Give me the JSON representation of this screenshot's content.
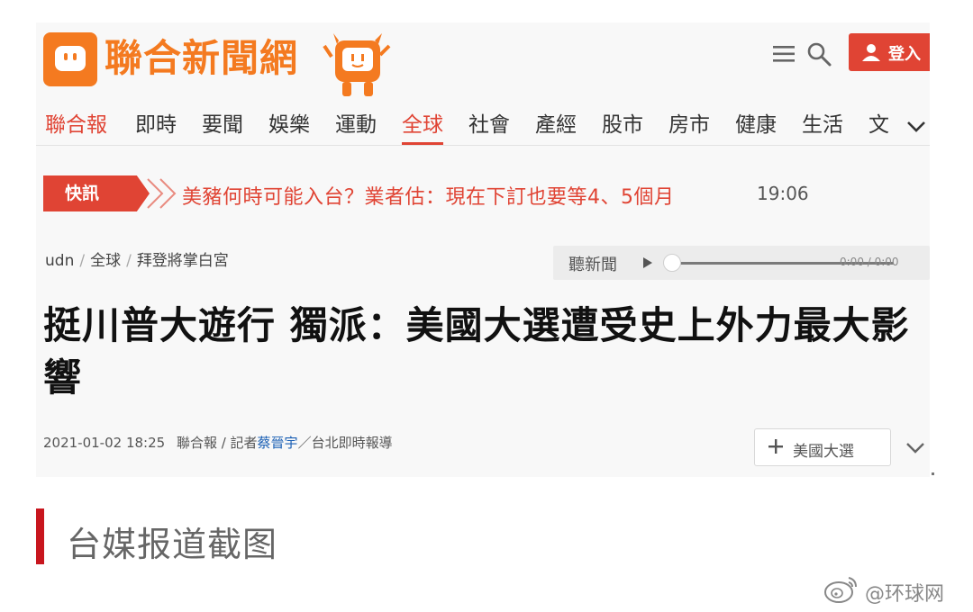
{
  "header": {
    "site_name": "聯合新聞網",
    "mascot_label": "udn",
    "login_label": "登入"
  },
  "nav": {
    "items": [
      "聯合報",
      "即時",
      "要聞",
      "娛樂",
      "運動",
      "全球",
      "社會",
      "產經",
      "股市",
      "房市",
      "健康",
      "生活",
      "文"
    ],
    "active": "全球"
  },
  "breaking": {
    "tag": "快訊",
    "headline": "美豬何時可能入台？業者估：現在下訂也要等4、5個月",
    "time": "19:06"
  },
  "breadcrumb": {
    "items": [
      "udn",
      "全球",
      "拜登將掌白宮"
    ]
  },
  "player": {
    "label": "聽新聞",
    "time": "0:00 / 0:00"
  },
  "article": {
    "title": "挺川普大遊行 獨派：美國大選遭受史上外力最大影響",
    "datetime": "2021-01-02 18:25",
    "source": "聯合報 / 記者",
    "reporter": "蔡晉宇",
    "bureau": "／台北即時報導",
    "tag_button": "美國大選"
  },
  "caption": {
    "text": "台媒报道截图"
  },
  "watermark": {
    "text": "@环球网"
  },
  "colors": {
    "brand_orange": "#f47a20",
    "accent_red": "#e04434",
    "caption_bar": "#c8161e"
  },
  "icons": [
    "menu-icon",
    "search-icon",
    "user-icon",
    "play-icon",
    "plus-icon",
    "chevron-down-icon",
    "weibo-icon"
  ]
}
